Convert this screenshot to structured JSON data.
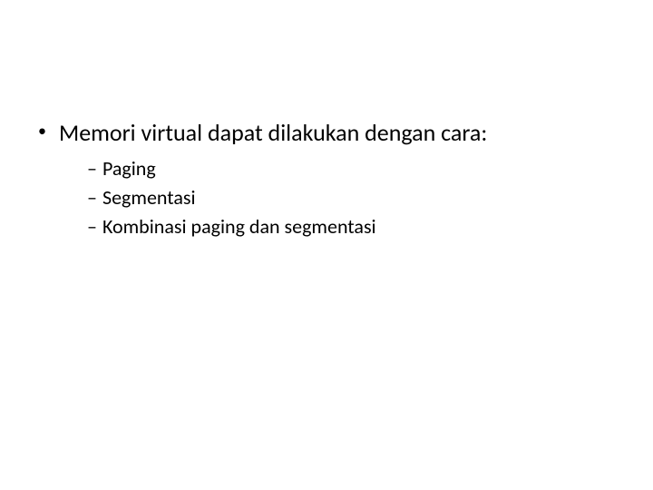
{
  "slide": {
    "bullet": {
      "marker": "•",
      "text": "Memori virtual dapat dilakukan dengan cara:"
    },
    "subitems": [
      {
        "marker": "–",
        "text": "Paging"
      },
      {
        "marker": "–",
        "text": "Segmentasi"
      },
      {
        "marker": "–",
        "text": "Kombinasi paging dan segmentasi"
      }
    ]
  }
}
